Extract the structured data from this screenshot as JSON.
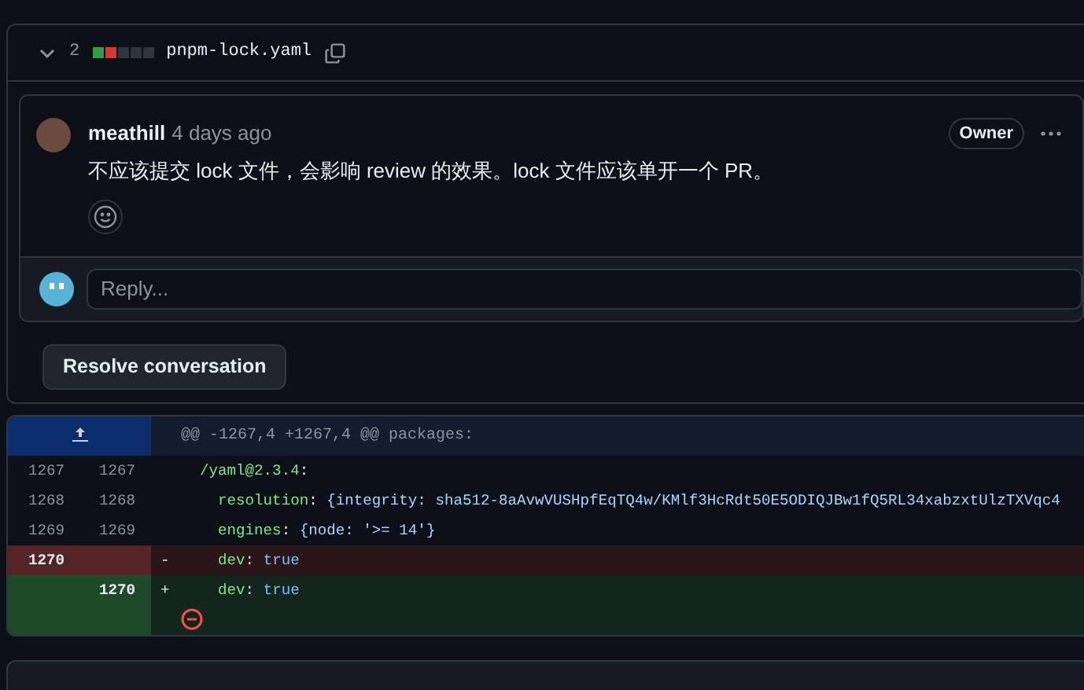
{
  "file": {
    "expanded": true,
    "changes": "2",
    "diffstat": [
      {
        "color": "#2ea043"
      },
      {
        "color": "#da3633"
      },
      {
        "color": "#30363d"
      },
      {
        "color": "#30363d"
      },
      {
        "color": "#30363d"
      }
    ],
    "name": "pnpm-lock.yaml"
  },
  "comment": {
    "author": "meathill",
    "time": "4 days ago",
    "badge": "Owner",
    "body": "不应该提交 lock 文件，会影响 review 的效果。lock 文件应该单开一个 PR。"
  },
  "reply": {
    "placeholder": "Reply..."
  },
  "resolve_button": "Resolve conversation",
  "hunk_header": "@@ -1267,4 +1267,4 @@ packages:",
  "lines": [
    {
      "kind": "context",
      "old": "1267",
      "new": "1267",
      "tokens": [
        {
          "kind": "key",
          "text": "/yaml@2.3.4"
        },
        {
          "kind": "punct",
          "text": ":"
        }
      ]
    },
    {
      "kind": "context",
      "old": "1268",
      "new": "1268",
      "tokens": [
        {
          "kind": "key",
          "text": "  resolution"
        },
        {
          "kind": "punct",
          "text": ": "
        },
        {
          "kind": "string",
          "text": "{integrity: sha512-8aAvwVUSHpfEqTQ4w/KMlf3HcRdt50E5ODIQJBw1fQ5RL34xabzxtUlzTXVqc4"
        }
      ]
    },
    {
      "kind": "context",
      "old": "1269",
      "new": "1269",
      "tokens": [
        {
          "kind": "key",
          "text": "  engines"
        },
        {
          "kind": "punct",
          "text": ": "
        },
        {
          "kind": "string",
          "text": "{node: '>= 14'}"
        }
      ]
    },
    {
      "kind": "deleted",
      "old": "1270",
      "sign": "-",
      "tokens": [
        {
          "kind": "key",
          "text": "  dev"
        },
        {
          "kind": "punct",
          "text": ": "
        },
        {
          "kind": "literal",
          "text": "true"
        }
      ]
    },
    {
      "kind": "added",
      "new": "1270",
      "sign": "+",
      "tokens": [
        {
          "kind": "key",
          "text": "  dev"
        },
        {
          "kind": "punct",
          "text": ": "
        },
        {
          "kind": "literal",
          "text": "true"
        }
      ],
      "error_marker": true
    }
  ]
}
